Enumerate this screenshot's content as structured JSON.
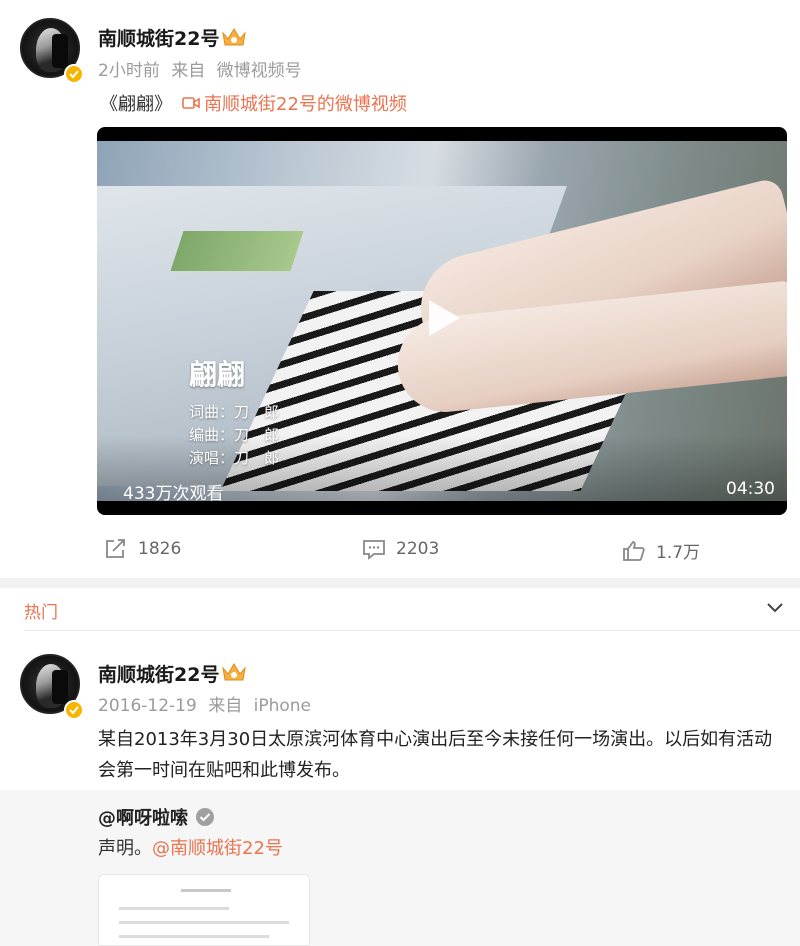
{
  "post": {
    "username": "南顺城街22号",
    "time": "2小时前",
    "source_prefix": "来自",
    "source": "微博视频号",
    "song_title": "《翩翩》",
    "video_link": "南顺城街22号的微博视频",
    "video": {
      "overlay_title": "翩翩",
      "credits": [
        "词曲：刀　郎",
        "编曲：刀　郎",
        "演唱：刀　郎"
      ],
      "views": "433万次观看",
      "duration": "04:30"
    },
    "actions": {
      "repost_count": "1826",
      "comment_count": "2203",
      "like_count": "1.7万"
    }
  },
  "hot": {
    "label": "热门"
  },
  "second_post": {
    "username": "南顺城街22号",
    "date": "2016-12-19",
    "source_prefix": "来自",
    "source": "iPhone",
    "content": "某自2013年3月30日太原滨河体育中心演出后至今未接任何一场演出。以后如有活动会第一时间在贴吧和此博发布。",
    "repost": {
      "user": "@啊呀啦嗦",
      "text_prefix": "声明。",
      "mention": "@南顺城街22号"
    }
  },
  "colors": {
    "accent": "#eb7350",
    "verified": "#f7b500",
    "meta_text": "#9b9b9b"
  }
}
